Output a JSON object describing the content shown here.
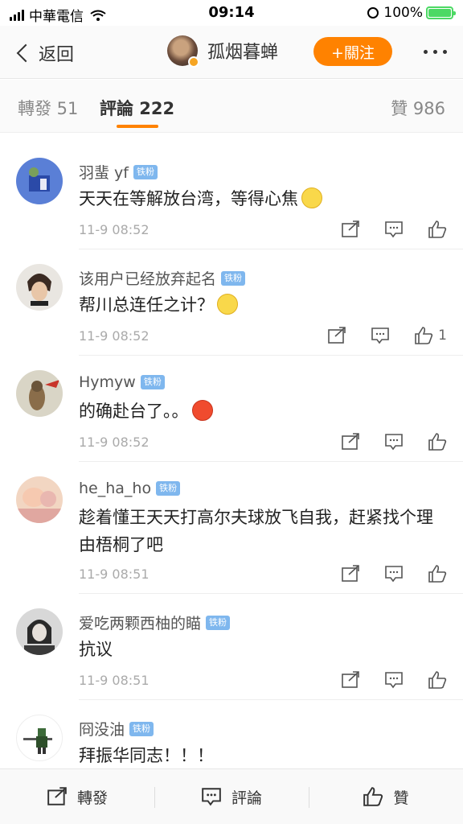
{
  "status_bar": {
    "carrier": "中華電信",
    "time": "09:14",
    "battery": "100%"
  },
  "nav": {
    "back_label": "返回",
    "user_name": "孤烟暮蝉",
    "follow_label": "+關注"
  },
  "tabs": {
    "repost": "轉發 51",
    "comment": "評論 222",
    "like": "贊 986"
  },
  "comments": [
    {
      "name": "羽蜚 yf",
      "badge": "铁粉",
      "text": "天天在等解放台湾，等得心焦",
      "time": "11-9 08:52",
      "likes": ""
    },
    {
      "name": "该用户已经放弃起名",
      "badge": "铁粉",
      "text": "帮川总连任之计？",
      "time": "11-9 08:52",
      "likes": "1"
    },
    {
      "name": "Hymyw",
      "badge": "铁粉",
      "text": "的确赴台了。。",
      "time": "11-9 08:52",
      "likes": ""
    },
    {
      "name": "he_ha_ho",
      "badge": "铁粉",
      "text": "趁着懂王天天打高尔夫球放飞自我，赶紧找个理由梧桐了吧",
      "time": "11-9 08:51",
      "likes": ""
    },
    {
      "name": "爱吃两颗西柚的瞄",
      "badge": "铁粉",
      "text": "抗议",
      "time": "11-9 08:51",
      "likes": ""
    },
    {
      "name": "冏没油",
      "badge": "铁粉",
      "text": "拜振华同志！！！",
      "time": "",
      "likes": ""
    }
  ],
  "bottom_bar": {
    "repost": "轉發",
    "comment": "評論",
    "like": "贊"
  },
  "colors": {
    "accent": "#ff8200",
    "fan_badge": "#7fb7ee",
    "battery": "#4cd964"
  }
}
